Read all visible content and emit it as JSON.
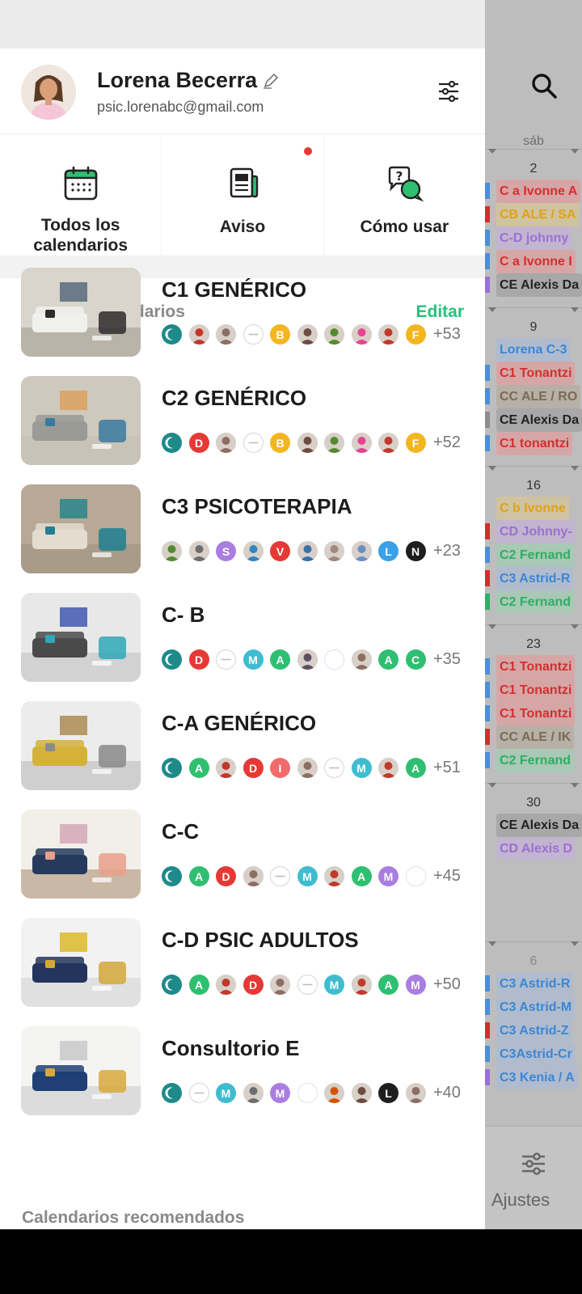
{
  "profile": {
    "name": "Lorena Becerra",
    "email": "psic.lorenabc@gmail.com"
  },
  "quick_actions": [
    {
      "label": "Todos los calendarios",
      "icon": "calendar-icon"
    },
    {
      "label": "Aviso",
      "icon": "news-icon",
      "has_badge": true
    },
    {
      "label": "Cómo usar",
      "icon": "help-chat-icon"
    }
  ],
  "list": {
    "title": "Lista de calendarios",
    "edit_label": "Editar"
  },
  "calendars": [
    {
      "name": "C1 GENÉRICO",
      "more": "+53",
      "members": [
        "logo",
        "photo:#c0392b",
        "photo:#8d6e63",
        "ring",
        "B:#f3b61f",
        "photo:#6d4c41",
        "photo:#558b2f",
        "photo:#e84393",
        "photo:#c0392b",
        "F:#f3b61f"
      ]
    },
    {
      "name": "C2 GENÉRICO",
      "more": "+52",
      "members": [
        "logo",
        "D:#e53935",
        "photo:#8d6e63",
        "ring",
        "B:#f3b61f",
        "photo:#6d4c41",
        "photo:#558b2f",
        "photo:#e84393",
        "photo:#c0392b",
        "F:#f3b61f"
      ]
    },
    {
      "name": "C3 PSICOTERAPIA",
      "more": "+23",
      "members": [
        "photo:#558b2f",
        "photo:#6d6d6d",
        "S:#a97ee0",
        "photo:#2e86c1",
        "V:#e53935",
        "photo:#3a6fa8",
        "photo:#a1887f",
        "photo:#6b8ec2",
        "L:#3aa0e8",
        "N:#1e1e1e"
      ]
    },
    {
      "name": "C- B",
      "more": "+35",
      "members": [
        "logo",
        "D:#e53935",
        "ring",
        "M:#3fbcd0",
        "A:#2fbf71",
        "photo:#5d4e60",
        "crescent",
        "photo:#8d6e63",
        "A:#2fbf71",
        "C:#2fbf71"
      ]
    },
    {
      "name": "C-A GENÉRICO",
      "more": "+51",
      "members": [
        "logo",
        "A:#2fbf71",
        "photo:#c0392b",
        "D:#e53935",
        "I:#f26b6b",
        "photo:#8d6e63",
        "ring",
        "M:#3fbcd0",
        "photo:#c0392b",
        "A:#2fbf71"
      ]
    },
    {
      "name": "C-C",
      "more": "+45",
      "members": [
        "logo",
        "A:#2fbf71",
        "D:#e53935",
        "photo:#8d6e63",
        "ring",
        "M:#3fbcd0",
        "photo:#c0392b",
        "A:#2fbf71",
        "M:#a97ee0",
        "crescent"
      ]
    },
    {
      "name": "C-D PSIC ADULTOS",
      "more": "+50",
      "members": [
        "logo",
        "A:#2fbf71",
        "photo:#c0392b",
        "D:#e53935",
        "photo:#8d6e63",
        "ring",
        "M:#3fbcd0",
        "photo:#c0392b",
        "A:#2fbf71",
        "M:#a97ee0"
      ]
    },
    {
      "name": "Consultorio E",
      "more": "+40",
      "members": [
        "logo",
        "ring",
        "M:#3fbcd0",
        "photo:#6d6d6d",
        "M:#a97ee0",
        "crescent",
        "photo:#d35400",
        "photo:#6d4c41",
        "L:#1e1e1e",
        "photo:#8d6e63"
      ]
    }
  ],
  "recommended_title": "Calendarios recomendados",
  "background_calendar": {
    "day_label": "sáb",
    "weeks": [
      {
        "day": "2",
        "events": [
          {
            "text": "C a Ivonne A",
            "color": "#d32f2f",
            "bg": "#d6a6a6",
            "edge": "#4b8fd6"
          },
          {
            "text": "CB ALE / SA",
            "color": "#e0a21a",
            "bg": "#d0c3a0",
            "edge": "#d32f2f"
          },
          {
            "text": "C-D johnny",
            "color": "#9b6fd6",
            "bg": "#c2b5cf",
            "edge": "#4b8fd6"
          },
          {
            "text": "C a Ivonne I",
            "color": "#d32f2f",
            "bg": "#d6a6a6",
            "edge": "#4b8fd6"
          },
          {
            "text": "CE Alexis Da",
            "color": "#222222",
            "bg": "#a8a8a8",
            "edge": "#9b6fd6"
          }
        ]
      },
      {
        "day": "9",
        "events": [
          {
            "text": "Lorena C-3",
            "color": "#3b86d6",
            "bg": "#b0bccd",
            "edge": ""
          },
          {
            "text": "C1 Tonantzi",
            "color": "#d32f2f",
            "bg": "#d6a6a6",
            "edge": "#4b8fd6"
          },
          {
            "text": "CC ALE / RO",
            "color": "#7a6a55",
            "bg": "#b7b0a6",
            "edge": "#4b8fd6"
          },
          {
            "text": "CE Alexis Da",
            "color": "#222222",
            "bg": "#a8a8a8",
            "edge": "#8d8d8d"
          },
          {
            "text": "C1 tonantzi",
            "color": "#d32f2f",
            "bg": "#d6a6a6",
            "edge": "#4b8fd6"
          }
        ]
      },
      {
        "day": "16",
        "events": [
          {
            "text": "C b Ivonne",
            "color": "#e0a21a",
            "bg": "#d0c3a0",
            "edge": ""
          },
          {
            "text": "CD Johnny-",
            "color": "#9b6fd6",
            "bg": "#c2b5cf",
            "edge": "#d32f2f"
          },
          {
            "text": "C2 Fernand",
            "color": "#2fae64",
            "bg": "#a9c8b5",
            "edge": "#4b8fd6"
          },
          {
            "text": "C3 Astrid-R",
            "color": "#3b86d6",
            "bg": "#b0bccd",
            "edge": "#d32f2f"
          },
          {
            "text": "C2 Fernand",
            "color": "#2fae64",
            "bg": "#a9c8b5",
            "edge": "#2fae64"
          }
        ]
      },
      {
        "day": "23",
        "events": [
          {
            "text": "C1 Tonantzi",
            "color": "#d32f2f",
            "bg": "#d6a6a6",
            "edge": "#4b8fd6"
          },
          {
            "text": "C1 Tonantzi",
            "color": "#d32f2f",
            "bg": "#d6a6a6",
            "edge": "#4b8fd6"
          },
          {
            "text": "C1 Tonantzi",
            "color": "#d32f2f",
            "bg": "#d6a6a6",
            "edge": "#4b8fd6"
          },
          {
            "text": "CC ALE / IK",
            "color": "#7a6a55",
            "bg": "#b7b0a6",
            "edge": "#d32f2f"
          },
          {
            "text": "C2 Fernand",
            "color": "#2fae64",
            "bg": "#a9c8b5",
            "edge": "#4b8fd6"
          }
        ]
      },
      {
        "day": "30",
        "events": [
          {
            "text": "CE Alexis Da",
            "color": "#222222",
            "bg": "#a8a8a8",
            "edge": ""
          },
          {
            "text": "CD Alexis D",
            "color": "#9b6fd6",
            "bg": "#c2b5cf",
            "edge": ""
          }
        ]
      },
      {
        "day": "6",
        "events": [
          {
            "text": "C3 Astrid-R",
            "color": "#3b86d6",
            "bg": "#b0bccd",
            "edge": "#4b8fd6"
          },
          {
            "text": "C3 Astrid-M",
            "color": "#3b86d6",
            "bg": "#b0bccd",
            "edge": "#4b8fd6"
          },
          {
            "text": "C3 Astrid-Z",
            "color": "#3b86d6",
            "bg": "#b0bccd",
            "edge": "#d32f2f"
          },
          {
            "text": "C3Astrid-Cr",
            "color": "#3b86d6",
            "bg": "#b0bccd",
            "edge": "#4b8fd6"
          },
          {
            "text": "C3 Kenia / A",
            "color": "#3b86d6",
            "bg": "#b0bccd",
            "edge": "#9b6fd6"
          }
        ]
      }
    ],
    "settings_label": "Ajustes"
  },
  "colors": {
    "accent_green": "#27c07a",
    "badge_red": "#e53935"
  }
}
